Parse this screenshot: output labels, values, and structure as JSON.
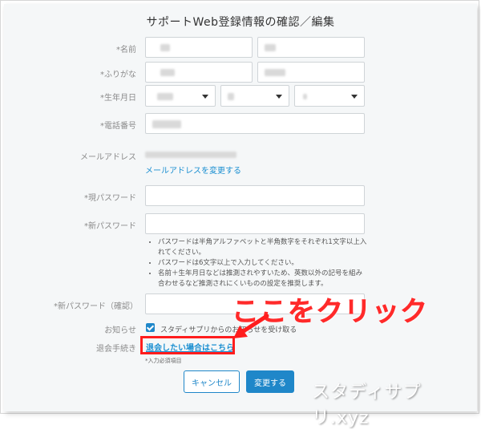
{
  "title": "サポートWeb登録情報の確認／編集",
  "fields": {
    "name_label": "*名前",
    "kana_label": "*ふりがな",
    "birth_label": "*生年月日",
    "phone_label": "*電話番号",
    "email_label": "メールアドレス",
    "email_change_link": "メールアドレスを変更する",
    "current_pw_label": "*現パスワード",
    "new_pw_label": "*新パスワード",
    "confirm_pw_label": "*新パスワード（確認）",
    "notice_label": "お知らせ",
    "withdraw_label": "退会手続き"
  },
  "password_hints": [
    "パスワードは半角アルファベットと半角数字をそれぞれ1文字以上入れてください。",
    "パスワードは6文字以上で入力してください。",
    "名前＋生年月日などは推測されやすいため、英数以外の記号を組み合わせるなど推測されにくいものの設定を推奨します。"
  ],
  "notice_checkbox": {
    "label": "スタディサプリからのお知らせを受け取る",
    "checked": true
  },
  "withdraw_link": "退会したい場合はこちら",
  "required_note": "*入力必須項目",
  "buttons": {
    "cancel": "キャンセル",
    "submit": "変更する"
  },
  "annotation": {
    "text": "ここをクリック",
    "color": "#ff2a2a"
  },
  "watermark": "スタディサプリ.xyz",
  "colors": {
    "accent": "#1f87c9",
    "link": "#1b8fd1",
    "highlight": "#ff1d1d"
  }
}
